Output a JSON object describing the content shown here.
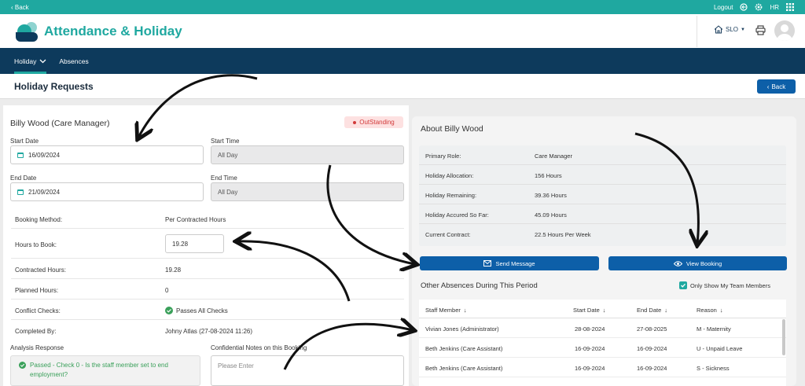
{
  "topbar": {
    "back": "Back",
    "logout": "Logout",
    "user_initials": "HR"
  },
  "header": {
    "app_title": "Attendance & Holiday",
    "location": "SLO"
  },
  "nav": {
    "tabs": [
      {
        "label": "Holiday"
      },
      {
        "label": "Absences"
      }
    ]
  },
  "page": {
    "title": "Holiday Requests",
    "back_button": "Back"
  },
  "request": {
    "employee": "Billy Wood (Care Manager)",
    "status": "OutStanding",
    "start_date_label": "Start Date",
    "start_date": "16/09/2024",
    "start_time_label": "Start Time",
    "start_time": "All Day",
    "end_date_label": "End Date",
    "end_date": "21/09/2024",
    "end_time_label": "End Time",
    "end_time": "All Day",
    "rows": [
      {
        "label": "Booking Method:",
        "value": "Per Contracted Hours"
      },
      {
        "label": "Hours to Book:",
        "value": "19.28"
      },
      {
        "label": "Contracted Hours:",
        "value": "19.28"
      },
      {
        "label": "Planned Hours:",
        "value": "0"
      },
      {
        "label": "Conflict Checks:",
        "value": "Passes All Checks"
      },
      {
        "label": "Completed By:",
        "value": "Johny Atlas (27-08-2024 11:26)"
      }
    ],
    "analysis_label": "Analysis Response",
    "analysis_text": "Passed - Check 0 - Is the staff member set to end employment?",
    "notes_label": "Confidential Notes on this Booking",
    "notes_placeholder": "Please Enter"
  },
  "about": {
    "title": "About Billy Wood",
    "rows": [
      {
        "label": "Primary Role:",
        "value": "Care Manager"
      },
      {
        "label": "Holiday Allocation:",
        "value": "156 Hours"
      },
      {
        "label": "Holiday Remaining:",
        "value": "39.36 Hours"
      },
      {
        "label": "Holiday Accured So Far:",
        "value": "45.09 Hours"
      },
      {
        "label": "Current Contract:",
        "value": "22.5 Hours Per Week"
      }
    ],
    "send_message": "Send Message",
    "view_booking": "View Booking"
  },
  "absences": {
    "title": "Other Absences During This Period",
    "team_only_label": "Only Show My Team Members",
    "team_only_checked": true,
    "columns": [
      "Staff Member",
      "Start Date",
      "End Date",
      "Reason"
    ],
    "rows": [
      [
        "Vivian Jones (Administrator)",
        "28-08-2024",
        "27-08-2025",
        "M - Maternity"
      ],
      [
        "Beth Jenkins (Care Assistant)",
        "16-09-2024",
        "16-09-2024",
        "U - Unpaid Leave"
      ],
      [
        "Beth Jenkins (Care Assistant)",
        "16-09-2024",
        "16-09-2024",
        "S - Sickness"
      ]
    ]
  },
  "colors": {
    "teal": "#1fa8a0",
    "navy": "#0d3a5c",
    "blue": "#0d5fa8",
    "danger": "#d23a3a",
    "success": "#3aa05a"
  }
}
